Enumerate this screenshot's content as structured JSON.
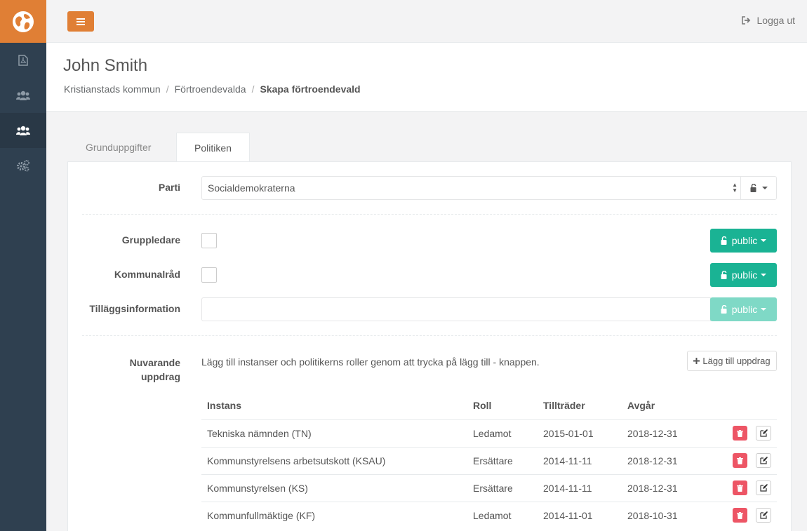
{
  "topbar": {
    "logout_label": "Logga ut"
  },
  "heading": {
    "title": "John Smith",
    "breadcrumb": [
      "Kristianstads kommun",
      "Förtroendevalda",
      "Skapa förtroendevald"
    ]
  },
  "tabs": [
    {
      "label": "Grunduppgifter",
      "active": false
    },
    {
      "label": "Politiken",
      "active": true
    }
  ],
  "form": {
    "parti": {
      "label": "Parti",
      "value": "Socialdemokraterna"
    },
    "gruppledare": {
      "label": "Gruppledare",
      "checked": false,
      "visibility": "public"
    },
    "kommunalrad": {
      "label": "Kommunalråd",
      "checked": false,
      "visibility": "public"
    },
    "tillagg": {
      "label": "Tilläggsinformation",
      "value": "",
      "visibility": "public"
    },
    "uppdrag": {
      "label_line1": "Nuvarande",
      "label_line2": "uppdrag",
      "help": "Lägg till instanser och politikerns roller genom att trycka på lägg till - knappen.",
      "add_label": "Lägg till uppdrag"
    }
  },
  "table": {
    "headers": [
      "Instans",
      "Roll",
      "Tillträder",
      "Avgår"
    ],
    "rows": [
      [
        "Tekniska nämnden (TN)",
        "Ledamot",
        "2015-01-01",
        "2018-12-31"
      ],
      [
        "Kommunstyrelsens arbetsutskott (KSAU)",
        "Ersättare",
        "2014-11-11",
        "2018-12-31"
      ],
      [
        "Kommunstyrelsen (KS)",
        "Ersättare",
        "2014-11-11",
        "2018-12-31"
      ],
      [
        "Kommunfullmäktige (KF)",
        "Ledamot",
        "2014-11-01",
        "2018-10-31"
      ]
    ]
  },
  "colors": {
    "accent": "#e07f35",
    "sidebar": "#2f4050",
    "success": "#1ab394",
    "danger": "#ed5565"
  }
}
